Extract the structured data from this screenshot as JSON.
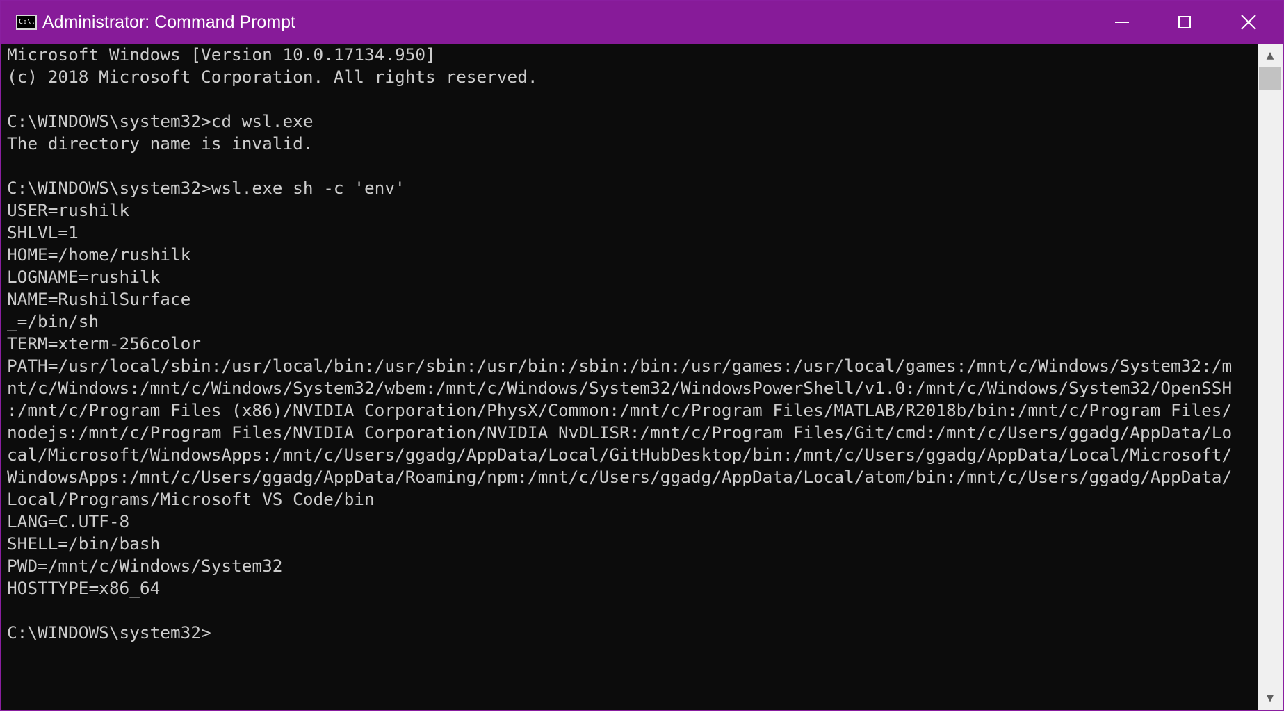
{
  "window": {
    "title": "Administrator: Command Prompt",
    "app_icon_text": "C:\\.",
    "title_bar_color": "#871b99",
    "controls": {
      "minimize_icon": "minimize-icon",
      "maximize_icon": "maximize-icon",
      "close_icon": "close-icon",
      "close_glyph": "✕"
    }
  },
  "console": {
    "background": "#0c0c0c",
    "foreground": "#cccccc",
    "lines": [
      "Microsoft Windows [Version 10.0.17134.950]",
      "(c) 2018 Microsoft Corporation. All rights reserved.",
      "",
      "C:\\WINDOWS\\system32>cd wsl.exe",
      "The directory name is invalid.",
      "",
      "C:\\WINDOWS\\system32>wsl.exe sh -c 'env'",
      "USER=rushilk",
      "SHLVL=1",
      "HOME=/home/rushilk",
      "LOGNAME=rushilk",
      "NAME=RushilSurface",
      "_=/bin/sh",
      "TERM=xterm-256color",
      "PATH=/usr/local/sbin:/usr/local/bin:/usr/sbin:/usr/bin:/sbin:/bin:/usr/games:/usr/local/games:/mnt/c/Windows/System32:/m",
      "nt/c/Windows:/mnt/c/Windows/System32/wbem:/mnt/c/Windows/System32/WindowsPowerShell/v1.0:/mnt/c/Windows/System32/OpenSSH",
      ":/mnt/c/Program Files (x86)/NVIDIA Corporation/PhysX/Common:/mnt/c/Program Files/MATLAB/R2018b/bin:/mnt/c/Program Files/",
      "nodejs:/mnt/c/Program Files/NVIDIA Corporation/NVIDIA NvDLISR:/mnt/c/Program Files/Git/cmd:/mnt/c/Users/ggadg/AppData/Lo",
      "cal/Microsoft/WindowsApps:/mnt/c/Users/ggadg/AppData/Local/GitHubDesktop/bin:/mnt/c/Users/ggadg/AppData/Local/Microsoft/",
      "WindowsApps:/mnt/c/Users/ggadg/AppData/Roaming/npm:/mnt/c/Users/ggadg/AppData/Local/atom/bin:/mnt/c/Users/ggadg/AppData/",
      "Local/Programs/Microsoft VS Code/bin",
      "LANG=C.UTF-8",
      "SHELL=/bin/bash",
      "PWD=/mnt/c/Windows/System32",
      "HOSTTYPE=x86_64",
      "",
      "C:\\WINDOWS\\system32>"
    ]
  },
  "scrollbar": {
    "up_arrow": "▲",
    "down_arrow": "▼"
  }
}
